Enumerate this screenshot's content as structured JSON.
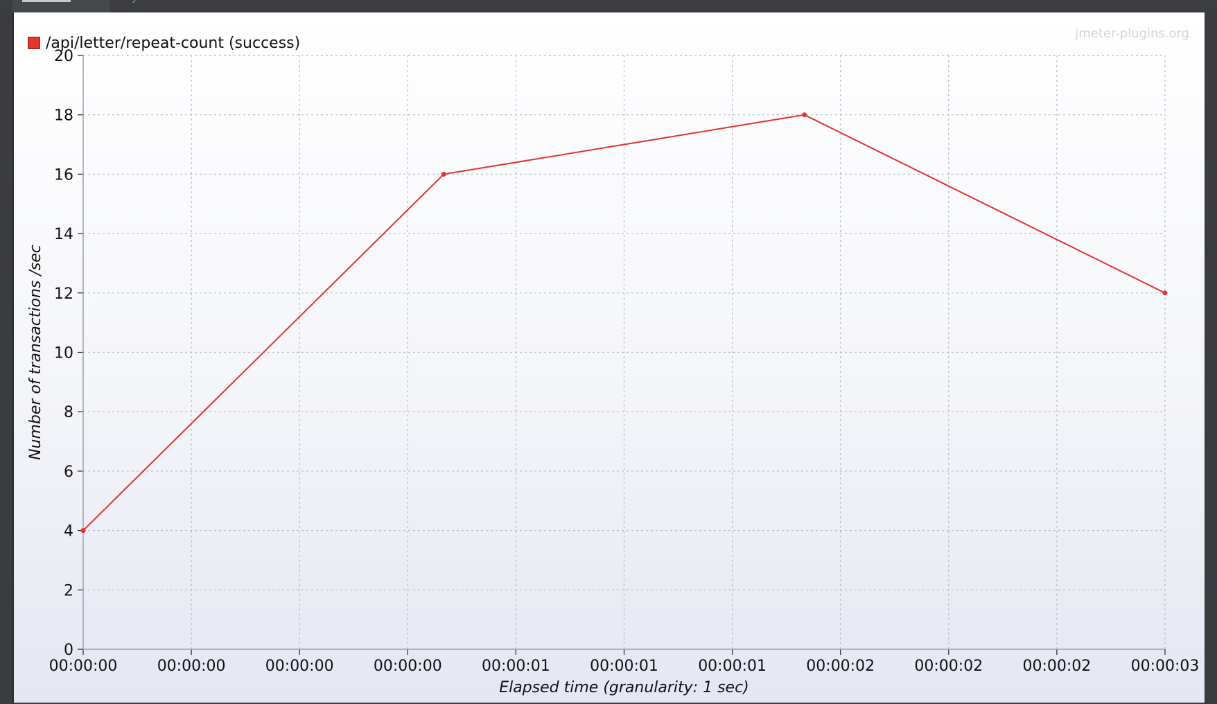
{
  "watermark": "jmeter-plugins.org",
  "colors": {
    "series": "#e3342f",
    "grid": "#b9bcc4",
    "axis": "#222222"
  },
  "chart_data": {
    "type": "line",
    "title": "",
    "xlabel": "Elapsed time (granularity: 1 sec)",
    "ylabel": "Number of transactions /sec",
    "ylim": [
      0,
      20
    ],
    "yticks": [
      0,
      2,
      4,
      6,
      8,
      10,
      12,
      14,
      16,
      18,
      20
    ],
    "xticks": [
      "00:00:00",
      "00:00:00",
      "00:00:00",
      "00:00:00",
      "00:00:01",
      "00:00:01",
      "00:00:01",
      "00:00:02",
      "00:00:02",
      "00:00:02",
      "00:00:03"
    ],
    "xlim": [
      0,
      3
    ],
    "grid": true,
    "legend_position": "top-left",
    "series": [
      {
        "name": "/api/letter/repeat-count (success)",
        "x": [
          0,
          1,
          2,
          3
        ],
        "y": [
          4,
          16,
          18,
          12
        ]
      }
    ]
  }
}
